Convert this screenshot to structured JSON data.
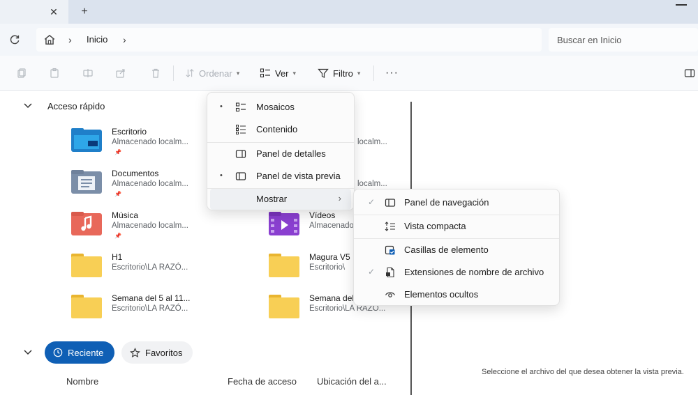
{
  "tabbar": {
    "close_glyph": "✕",
    "new_tab_glyph": "+"
  },
  "address": {
    "crumbs": [
      "Inicio"
    ],
    "chevron": "›",
    "search_placeholder": "Buscar en Inicio"
  },
  "toolbar": {
    "sort_label": "Ordenar",
    "view_label": "Ver",
    "filter_label": "Filtro",
    "more_label": "···"
  },
  "quick_access": {
    "title": "Acceso rápido",
    "items": [
      {
        "name": "Escritorio",
        "sub": "Almacenado localm...",
        "icon": "desktop-folder-icon"
      },
      {
        "name": "Documentos",
        "sub": "Almacenado localm...",
        "icon": "documents-folder-icon"
      },
      {
        "name": "Música",
        "sub": "Almacenado localm...",
        "icon": "music-folder-icon"
      },
      {
        "name": "H1",
        "sub": "Escritorio\\LA RAZÓ...",
        "icon": "folder-icon"
      },
      {
        "name": "Semana del 5 al 11...",
        "sub": "Escritorio\\LA RAZÓ...",
        "icon": "folder-icon"
      },
      {
        "name": "Vídeos",
        "sub": "Almacenado",
        "icon": "videos-folder-icon"
      },
      {
        "name": "Magura V5",
        "sub": "Escritorio\\",
        "icon": "folder-icon"
      },
      {
        "name": "Semana del",
        "sub": "Escritorio\\LA RAZÓ...",
        "icon": "folder-icon"
      }
    ],
    "partial_sub_1": "localm...",
    "partial_sub_2": "localm..."
  },
  "recent": {
    "tab_recent": "Reciente",
    "tab_favorites": "Favoritos",
    "columns": [
      "Nombre",
      "Fecha de acceso",
      "Ubicación del a..."
    ]
  },
  "view_menu": {
    "items": [
      {
        "label": "Mosaicos",
        "mark": "•"
      },
      {
        "label": "Contenido",
        "mark": ""
      },
      {
        "label": "Panel de detalles",
        "mark": ""
      },
      {
        "label": "Panel de vista previa",
        "mark": "•"
      },
      {
        "label": "Mostrar",
        "mark": "",
        "arrow": "›"
      }
    ]
  },
  "show_menu": {
    "items": [
      {
        "label": "Panel de navegación",
        "mark": "✓"
      },
      {
        "label": "Vista compacta",
        "mark": ""
      },
      {
        "label": "Casillas de elemento",
        "mark": ""
      },
      {
        "label": "Extensiones de nombre de archivo",
        "mark": "✓"
      },
      {
        "label": "Elementos ocultos",
        "mark": ""
      }
    ]
  },
  "preview": {
    "message": "Seleccione el archivo del que desea obtener la vista previa."
  },
  "colors": {
    "accent": "#0f5fb5",
    "folder": "#f5c842",
    "tabbar": "#dbe3ee"
  }
}
